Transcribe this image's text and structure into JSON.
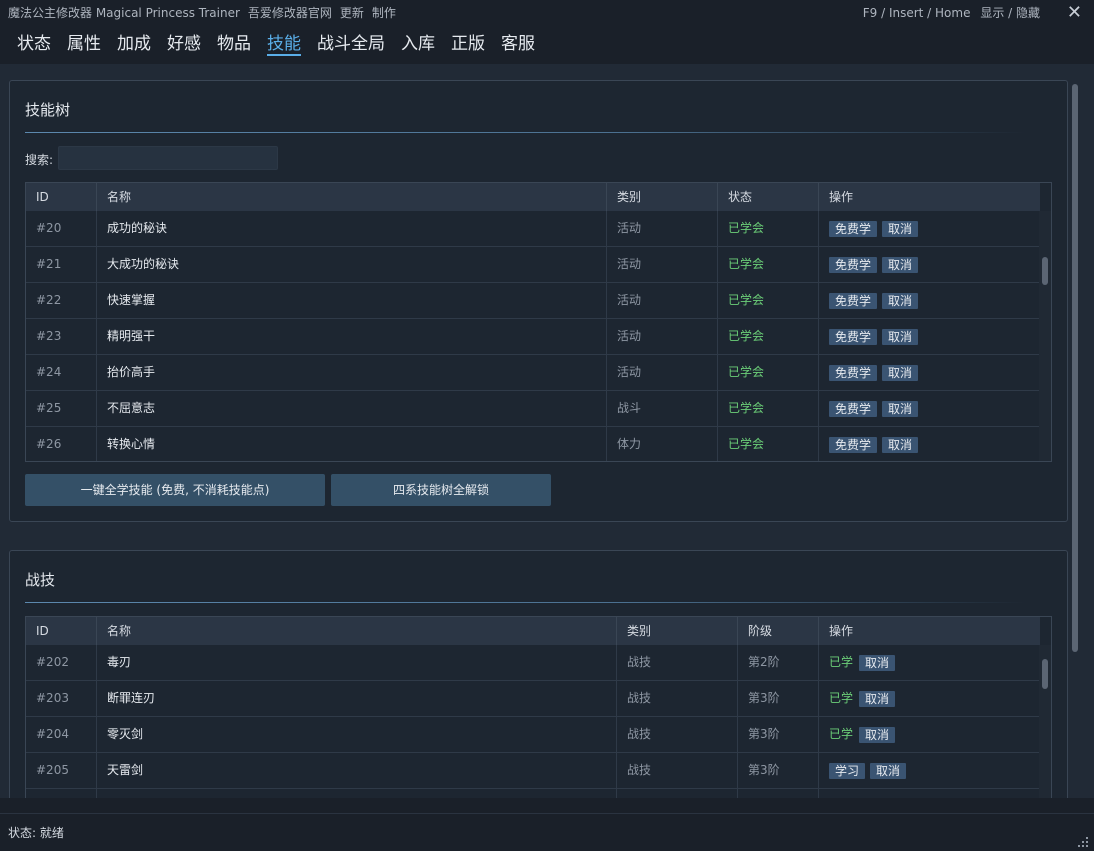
{
  "titlebar": {
    "app_title": "魔法公主修改器 Magical Princess Trainer",
    "link_site": "吾爱修改器官网",
    "link_update": "更新",
    "link_credits": "制作",
    "hotkey_hint": "F9 / Insert / Home",
    "toggle_label": "显示 / 隐藏",
    "close_glyph": "✕"
  },
  "nav": {
    "tabs": [
      {
        "label": "状态"
      },
      {
        "label": "属性"
      },
      {
        "label": "加成"
      },
      {
        "label": "好感"
      },
      {
        "label": "物品"
      },
      {
        "label": "技能",
        "active": true
      },
      {
        "label": "战斗全局"
      },
      {
        "label": "入库"
      },
      {
        "label": "正版"
      },
      {
        "label": "客服"
      }
    ]
  },
  "skill_tree": {
    "title": "技能树",
    "search_label": "搜索:",
    "search_value": "",
    "search_placeholder": "",
    "columns": [
      "ID",
      "名称",
      "类别",
      "状态",
      "操作"
    ],
    "rows": [
      {
        "id": "#20",
        "name": "成功的秘诀",
        "category": "活动",
        "status": "已学会",
        "btn_learn": "免费学",
        "btn_cancel": "取消"
      },
      {
        "id": "#21",
        "name": "大成功的秘诀",
        "category": "活动",
        "status": "已学会",
        "btn_learn": "免费学",
        "btn_cancel": "取消"
      },
      {
        "id": "#22",
        "name": "快速掌握",
        "category": "活动",
        "status": "已学会",
        "btn_learn": "免费学",
        "btn_cancel": "取消"
      },
      {
        "id": "#23",
        "name": "精明强干",
        "category": "活动",
        "status": "已学会",
        "btn_learn": "免费学",
        "btn_cancel": "取消"
      },
      {
        "id": "#24",
        "name": "抬价高手",
        "category": "活动",
        "status": "已学会",
        "btn_learn": "免费学",
        "btn_cancel": "取消"
      },
      {
        "id": "#25",
        "name": "不屈意志",
        "category": "战斗",
        "status": "已学会",
        "btn_learn": "免费学",
        "btn_cancel": "取消"
      },
      {
        "id": "#26",
        "name": "转换心情",
        "category": "体力",
        "status": "已学会",
        "btn_learn": "免费学",
        "btn_cancel": "取消"
      }
    ],
    "btn_learn_all": "一键全学技能 (免费, 不消耗技能点)",
    "btn_unlock_all": "四系技能树全解锁"
  },
  "combat_skills": {
    "title": "战技",
    "columns": [
      "ID",
      "名称",
      "类别",
      "阶级",
      "操作"
    ],
    "rows": [
      {
        "id": "#202",
        "name": "毒刃",
        "category": "战技",
        "tier": "第2阶",
        "learned": true,
        "learned_label": "已学",
        "btn_cancel": "取消"
      },
      {
        "id": "#203",
        "name": "断罪连刃",
        "category": "战技",
        "tier": "第3阶",
        "learned": true,
        "learned_label": "已学",
        "btn_cancel": "取消"
      },
      {
        "id": "#204",
        "name": "零灭剑",
        "category": "战技",
        "tier": "第3阶",
        "learned": true,
        "learned_label": "已学",
        "btn_cancel": "取消"
      },
      {
        "id": "#205",
        "name": "天雷剑",
        "category": "战技",
        "tier": "第3阶",
        "learned": false,
        "btn_learn": "学习",
        "btn_cancel": "取消"
      }
    ]
  },
  "statusbar": {
    "text": "状态: 就绪"
  },
  "colors": {
    "accent": "#5aaee8",
    "learned_green": "#6ccf78",
    "button_bg": "#3a5472"
  }
}
